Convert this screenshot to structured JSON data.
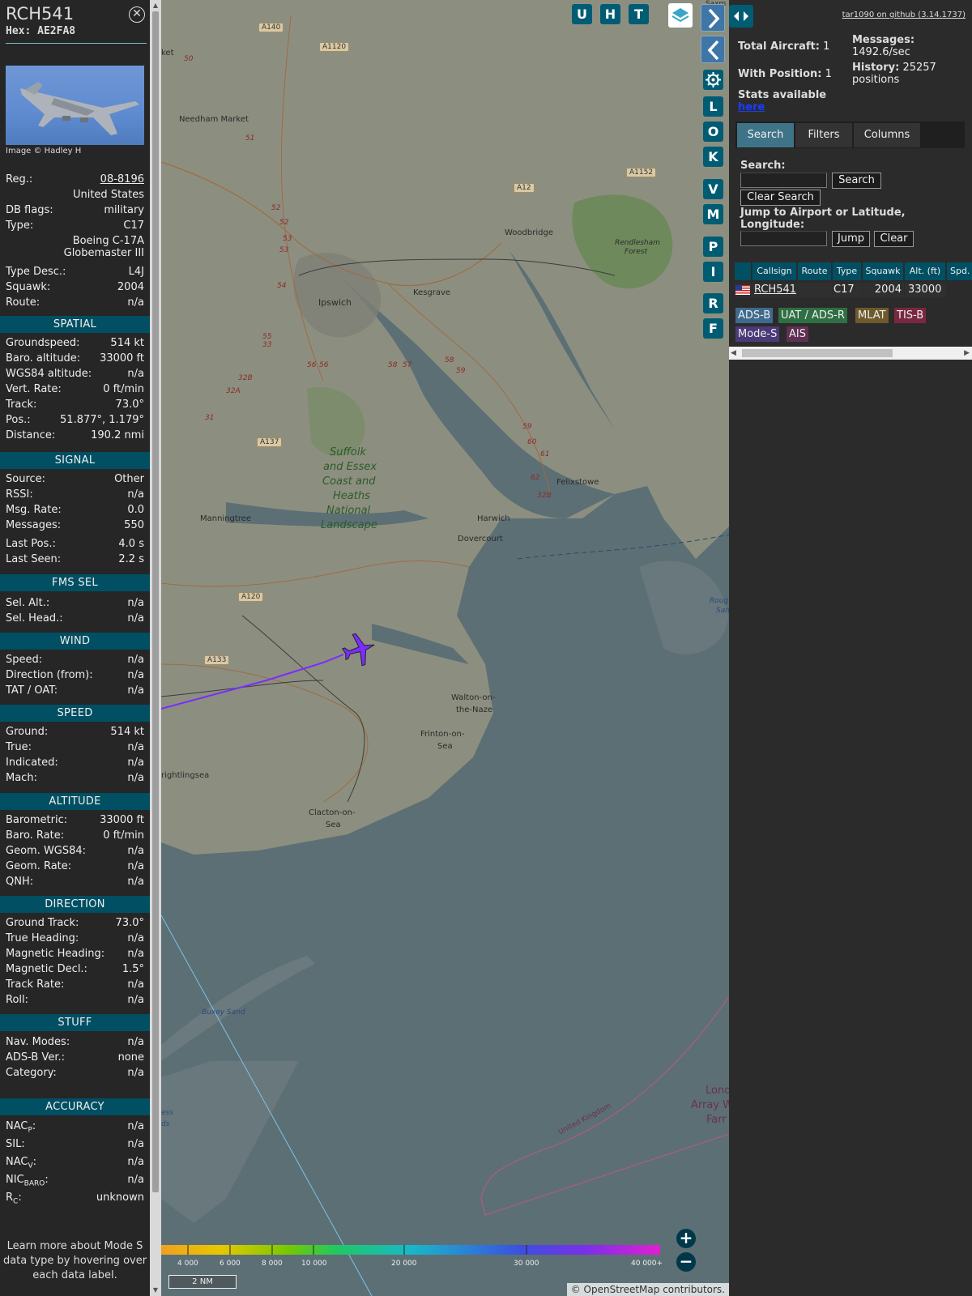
{
  "aircraft": {
    "callsign": "RCH541",
    "hex_label": "Hex: AE2FA8",
    "close_icon": "close-circle-icon",
    "image_credit": "Image © Hadley H",
    "info": [
      {
        "k": "Reg.:",
        "v": "08-8196"
      },
      {
        "k": "",
        "v": "United States"
      },
      {
        "k": "DB flags:",
        "v": "military"
      },
      {
        "k": "Type:",
        "v": "C17"
      },
      {
        "k": "",
        "v": "Boeing C-17A"
      },
      {
        "k": "",
        "v": "Globemaster III"
      },
      {
        "k": "Type Desc.:",
        "v": "L4J"
      },
      {
        "k": "Squawk:",
        "v": "2004"
      },
      {
        "k": "Route:",
        "v": "n/a"
      }
    ]
  },
  "sections": {
    "spatial": {
      "title": "SPATIAL",
      "rows": [
        {
          "k": "Groundspeed:",
          "v": "514 kt"
        },
        {
          "k": "Baro. altitude:",
          "v": "33000 ft"
        },
        {
          "k": "WGS84 altitude:",
          "v": "n/a"
        },
        {
          "k": "Vert. Rate:",
          "v": "0 ft/min"
        },
        {
          "k": "Track:",
          "v": "73.0°"
        },
        {
          "k": "Pos.:",
          "v": "51.877°, 1.179°"
        },
        {
          "k": "Distance:",
          "v": "190.2 nmi"
        }
      ]
    },
    "signal": {
      "title": "SIGNAL",
      "rows": [
        {
          "k": "Source:",
          "v": "Other"
        },
        {
          "k": "RSSI:",
          "v": "n/a"
        },
        {
          "k": "Msg. Rate:",
          "v": "0.0"
        },
        {
          "k": "Messages:",
          "v": "550"
        },
        {
          "k": "Last Pos.:",
          "v": "4.0 s"
        },
        {
          "k": "Last Seen:",
          "v": "2.2 s"
        }
      ]
    },
    "fms": {
      "title": "FMS SEL",
      "rows": [
        {
          "k": "Sel. Alt.:",
          "v": "n/a"
        },
        {
          "k": "Sel. Head.:",
          "v": "n/a"
        }
      ]
    },
    "wind": {
      "title": "WIND",
      "rows": [
        {
          "k": "Speed:",
          "v": "n/a"
        },
        {
          "k": "Direction (from):",
          "v": "n/a"
        },
        {
          "k": "TAT / OAT:",
          "v": "n/a"
        }
      ]
    },
    "speed": {
      "title": "SPEED",
      "rows": [
        {
          "k": "Ground:",
          "v": "514 kt"
        },
        {
          "k": "True:",
          "v": "n/a"
        },
        {
          "k": "Indicated:",
          "v": "n/a"
        },
        {
          "k": "Mach:",
          "v": "n/a"
        }
      ]
    },
    "altitude": {
      "title": "ALTITUDE",
      "rows": [
        {
          "k": "Barometric:",
          "v": "33000 ft"
        },
        {
          "k": "Baro. Rate:",
          "v": "0 ft/min"
        },
        {
          "k": "Geom. WGS84:",
          "v": "n/a"
        },
        {
          "k": "Geom. Rate:",
          "v": "n/a"
        },
        {
          "k": "QNH:",
          "v": "n/a"
        }
      ]
    },
    "direction": {
      "title": "DIRECTION",
      "rows": [
        {
          "k": "Ground Track:",
          "v": "73.0°"
        },
        {
          "k": "True Heading:",
          "v": "n/a"
        },
        {
          "k": "Magnetic Heading:",
          "v": "n/a"
        },
        {
          "k": "Magnetic Decl.:",
          "v": "1.5°"
        },
        {
          "k": "Track Rate:",
          "v": "n/a"
        },
        {
          "k": "Roll:",
          "v": "n/a"
        }
      ]
    },
    "stuff": {
      "title": "STUFF",
      "rows": [
        {
          "k": "Nav. Modes:",
          "v": "n/a"
        },
        {
          "k": "ADS-B Ver.:",
          "v": "none"
        },
        {
          "k": "Category:",
          "v": "n/a"
        }
      ]
    },
    "accuracy": {
      "title": "ACCURACY",
      "rows": [
        {
          "k": "NAC",
          "sub": "P",
          "k2": ":",
          "v": "n/a"
        },
        {
          "k": "SIL:",
          "sub": "",
          "k2": "",
          "v": "n/a"
        },
        {
          "k": "NAC",
          "sub": "V",
          "k2": ":",
          "v": "n/a"
        },
        {
          "k": "NIC",
          "sub": "BARO",
          "k2": ":",
          "v": "n/a"
        },
        {
          "k": "R",
          "sub": "C",
          "k2": ":",
          "v": "unknown"
        }
      ]
    }
  },
  "learn_more": "Learn more about Mode S data type by hovering over each data label.",
  "map": {
    "top_buttons": [
      "U",
      "H",
      "T"
    ],
    "layers_icon": "layers-icon",
    "nav_icons": [
      "chevron-right-icon",
      "chevron-left-icon",
      "gear-icon"
    ],
    "side_buttons": [
      "L",
      "O",
      "K",
      "V",
      "M",
      "P",
      "I",
      "R",
      "F"
    ],
    "places": [
      "Needham Market",
      "Ipswich",
      "Kesgrave",
      "Woodbridge",
      "Rendlesham",
      "Forest",
      "Suffolk",
      "and Essex",
      "Coast and",
      "Heaths",
      "National",
      "Landscape",
      "Manningtree",
      "Harwich",
      "Dovercourt",
      "Felixstowe",
      "Walton-on-",
      "the-Naze",
      "Frinton-on-",
      "Sea",
      "rightlingsea",
      "Clacton-on-",
      "Sea",
      "Buxey Sand",
      "United Kingdom",
      "Lond",
      "Array W",
      "Farr",
      "Roug",
      "San",
      "ess",
      "ds",
      "ket",
      "Saxm"
    ],
    "roads": [
      "A140",
      "A1120",
      "A1152",
      "A12",
      "A137",
      "A120",
      "A133"
    ],
    "road_numbers": [
      "50",
      "51",
      "52",
      "52",
      "53",
      "53",
      "54",
      "55",
      "33",
      "56",
      "56",
      "57",
      "58",
      "58",
      "59",
      "59",
      "60",
      "61",
      "62",
      "32B",
      "32B",
      "32A",
      "31"
    ],
    "legend_ticks": [
      "4 000",
      "6 000",
      "8 000",
      "10 000",
      "20 000",
      "30 000",
      "40 000+"
    ],
    "scale": "2 NM",
    "zoom_in": "+",
    "zoom_out": "−",
    "attribution_prefix": "© ",
    "attribution_link": "OpenStreetMap",
    "attribution_suffix": " contributors.",
    "plane_color": "#7b2cff",
    "track_color": "#7b2cff"
  },
  "right": {
    "github": "tar1090 on github (3.14.1737)",
    "toggle_icons": [
      "expand-arrows-icon"
    ],
    "total_label": "Total Aircraft:",
    "total_val": "1",
    "withpos_label": "With Position:",
    "withpos_val": "1",
    "messages_label": "Messages:",
    "messages_val": "1492.6/sec",
    "history_label": "History:",
    "history_val": "25257 positions",
    "stats_label": "Stats available",
    "stats_link": "here",
    "tabs": [
      "Search",
      "Filters",
      "Columns"
    ],
    "search_label": "Search:",
    "search_btn": "Search",
    "clear_search_btn": "Clear Search",
    "jump_label": "Jump to Airport or Latitude, Longitude:",
    "jump_btn": "Jump",
    "clear_btn": "Clear",
    "columns": [
      "",
      "Callsign",
      "Route",
      "Type",
      "Squawk",
      "Alt. (ft)",
      "Spd."
    ],
    "row": {
      "flag": "us-flag-icon",
      "callsign": "RCH541",
      "route": "",
      "type": "C17",
      "squawk": "2004",
      "alt": "33000"
    },
    "sources": [
      {
        "label": "ADS-B",
        "color": "#3f6a8e"
      },
      {
        "label": "UAT / ADS-R",
        "color": "#2f6f43"
      },
      {
        "label": "MLAT",
        "color": "#6e5a2b"
      },
      {
        "label": "TIS-B",
        "color": "#7a2840"
      },
      {
        "label": "Mode-S",
        "color": "#4b3a77"
      },
      {
        "label": "AIS",
        "color": "#5f3054"
      }
    ]
  }
}
